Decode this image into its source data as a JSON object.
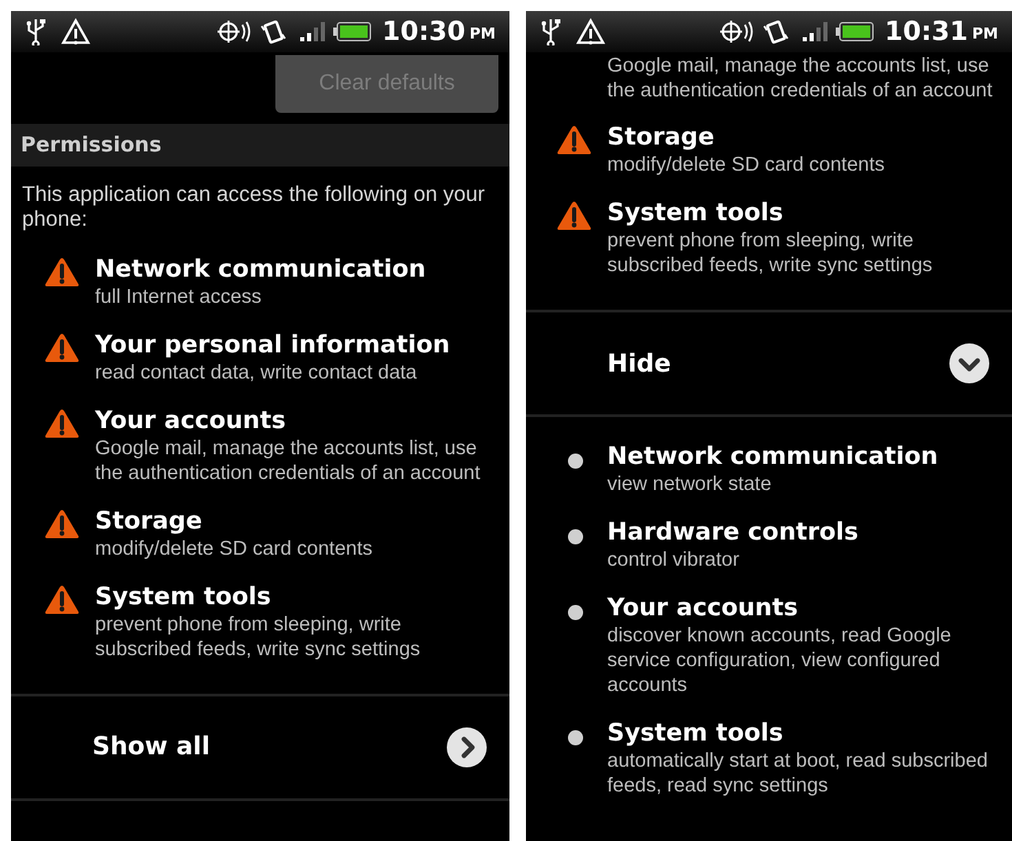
{
  "screens": [
    {
      "status_bar": {
        "time": "10:30",
        "ampm": "PM"
      },
      "items": [
        {
          "kind": "button",
          "label": "Clear defaults",
          "disabled": true
        },
        {
          "kind": "header",
          "text": "Permissions"
        },
        {
          "kind": "paragraph",
          "text": "This application can access the following on your phone:"
        },
        {
          "kind": "dangerous",
          "title": "Network communication",
          "description": "full Internet access"
        },
        {
          "kind": "dangerous",
          "title": "Your personal information",
          "description": "read contact data, write contact data"
        },
        {
          "kind": "dangerous",
          "title": "Your accounts",
          "description": "Google mail, manage the accounts list, use the authentication credentials of an account"
        },
        {
          "kind": "dangerous",
          "title": "Storage",
          "description": "modify/delete SD card contents"
        },
        {
          "kind": "dangerous",
          "title": "System tools",
          "description": "prevent phone from sleeping, write subscribed feeds, write sync settings"
        },
        {
          "kind": "toggle",
          "label": "Show all",
          "expanded": false
        }
      ]
    },
    {
      "status_bar": {
        "time": "10:31",
        "ampm": "PM"
      },
      "items": [
        {
          "kind": "fragment",
          "text": "Google mail, manage the accounts list, use the authentication credentials of an account"
        },
        {
          "kind": "dangerous",
          "title": "Storage",
          "description": "modify/delete SD card contents"
        },
        {
          "kind": "dangerous",
          "title": "System tools",
          "description": "prevent phone from sleeping, write subscribed feeds, write sync settings"
        },
        {
          "kind": "toggle",
          "label": "Hide",
          "expanded": true
        },
        {
          "kind": "normal",
          "title": "Network communication",
          "description": "view network state"
        },
        {
          "kind": "normal",
          "title": "Hardware controls",
          "description": "control vibrator"
        },
        {
          "kind": "normal",
          "title": "Your accounts",
          "description": "discover known accounts, read Google service configuration, view configured accounts"
        },
        {
          "kind": "normal",
          "title": "System tools",
          "description": "automatically start at boot, read subscribed feeds, read sync settings"
        }
      ]
    }
  ]
}
